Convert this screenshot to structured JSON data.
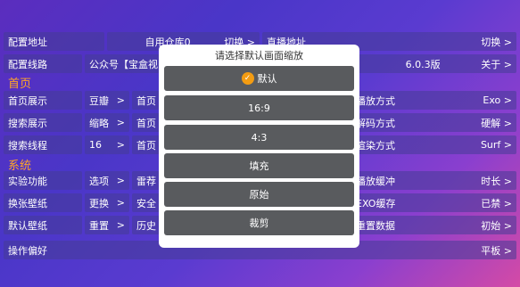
{
  "rows": [
    [
      "配置地址",
      "自用仓库0",
      "切换 >",
      "直播地址",
      "",
      "切换 >"
    ],
    [
      "配置线路",
      "公众号【宝盒视",
      "",
      "",
      "6.0.3版",
      "关于 >"
    ]
  ],
  "sections": {
    "home": "首页",
    "system": "系统"
  },
  "home_rows": [
    {
      "c1_k": "首页展示",
      "c1_v": "",
      "c2_k": "豆瓣",
      "c2_v": ">",
      "c3_k": "首页",
      "c4_k": "认",
      "c4_v": ">",
      "c5_k": "播放方式",
      "c5_v": "Exo >"
    },
    {
      "c1_k": "搜索展示",
      "c1_v": "",
      "c2_k": "缩略",
      "c2_v": ">",
      "c3_k": "首页",
      "c4_k": "启",
      "c4_v": ">",
      "c5_k": "解码方式",
      "c5_v": "硬解 >"
    },
    {
      "c1_k": "搜索线程",
      "c1_v": "",
      "c2_k": "16",
      "c2_v": ">",
      "c3_k": "首页",
      "c4_k": "开",
      "c4_v": ">",
      "c5_k": "渲染方式",
      "c5_v": "Surf >"
    }
  ],
  "system_rows": [
    {
      "c1_k": "实验功能",
      "c2_k": "选项",
      "c2_v": ">",
      "c3_k": "雷荐",
      "c4_k": "长",
      "c4_v": ">",
      "c5_k": "播放缓冲",
      "c5_v": "时长 >"
    },
    {
      "c1_k": "换张壁纸",
      "c2_k": "更换",
      "c2_v": ">",
      "c3_k": "安全",
      "c4_k": "空",
      "c4_v": ">",
      "c5_k": "EXO缓存",
      "c5_v": "已禁 >"
    },
    {
      "c1_k": "默认壁纸",
      "c2_k": "重置",
      "c2_v": ">",
      "c3_k": "历史",
      "c4_k": "作",
      "c4_v": ">",
      "c5_k": "重置数据",
      "c5_v": "初始 >"
    }
  ],
  "bottom_row": {
    "k": "操作偏好",
    "v": "平板 >"
  },
  "dialog": {
    "title": "请选择默认画面缩放",
    "options": [
      "默认",
      "16:9",
      "4:3",
      "填充",
      "原始",
      "裁剪"
    ],
    "selected_index": 0
  }
}
